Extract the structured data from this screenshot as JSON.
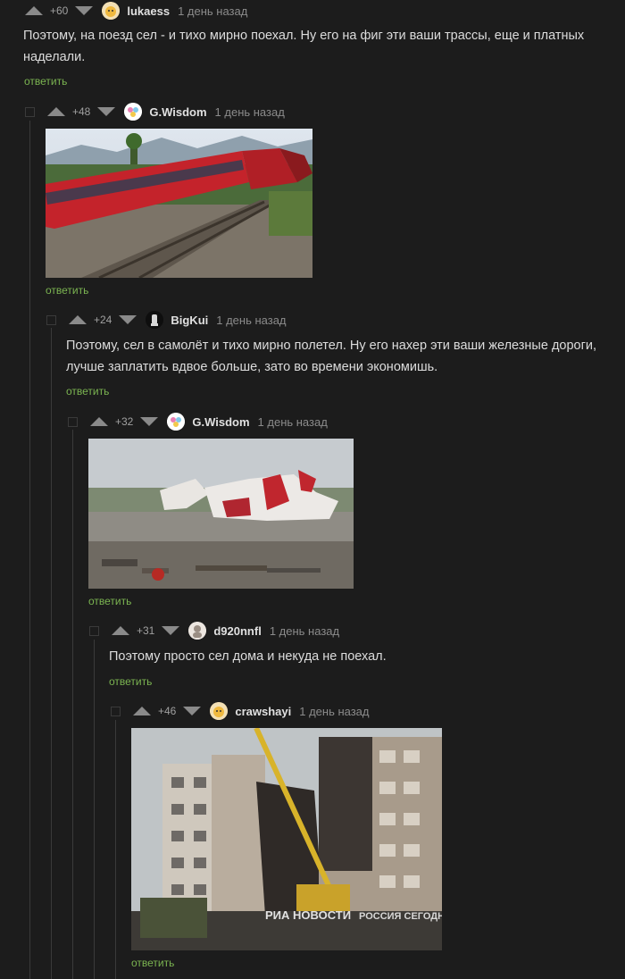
{
  "comments": [
    {
      "rating": "+60",
      "user": "lukaess",
      "time": "1 день назад",
      "text_lines": [
        "Поэтому, на поезд  сел - и тихо мирно поехал. Ну его на фиг эти ваши трассы, еще и платных",
        "наделали."
      ],
      "reply": "ответить"
    },
    {
      "rating": "+48",
      "user": "G.Wisdom",
      "time": "1 день назад",
      "image": "train-derailment-photo",
      "reply": "ответить"
    },
    {
      "rating": "+24",
      "user": "BigKui",
      "time": "1 день назад",
      "text_lines": [
        "Поэтому, сел в самолёт и тихо мирно полетел. Ну его нахер эти ваши железные дороги,",
        "лучше заплатить вдвое больше, зато во времени экономишь."
      ],
      "reply": "ответить"
    },
    {
      "rating": "+32",
      "user": "G.Wisdom",
      "time": "1 день назад",
      "image": "plane-crash-photo",
      "reply": "ответить"
    },
    {
      "rating": "+31",
      "user": "d920nnfl",
      "time": "1 день назад",
      "text_lines": [
        "Поэтому просто сел дома и некуда не поехал."
      ],
      "reply": "ответить"
    },
    {
      "rating": "+46",
      "user": "crawshayi",
      "time": "1 день назад",
      "image": "collapsed-building-photo",
      "watermark": "РИА НОВОСТИ",
      "watermark2": "РОССИЯ СЕГОДНЯ",
      "reply": "ответить"
    }
  ]
}
